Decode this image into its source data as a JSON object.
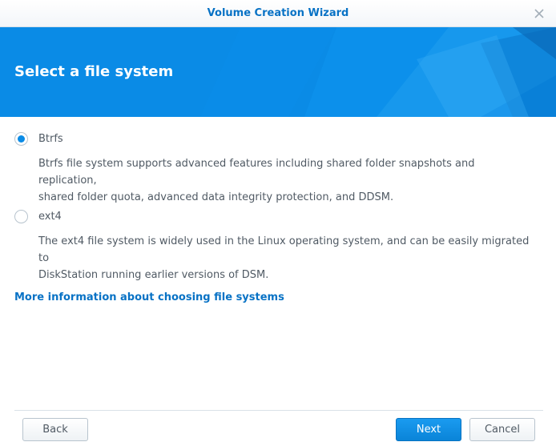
{
  "window": {
    "title": "Volume Creation Wizard"
  },
  "banner": {
    "title": "Select a file system"
  },
  "options": [
    {
      "label": "Btrfs",
      "checked": true,
      "description_line1": "Btrfs file system supports advanced features including shared folder snapshots and replication,",
      "description_line2": "shared folder quota, advanced data integrity protection, and DDSM."
    },
    {
      "label": "ext4",
      "checked": false,
      "description_line1": "The ext4 file system is widely used in the Linux operating system, and can be easily migrated to",
      "description_line2": "DiskStation running earlier versions of DSM."
    }
  ],
  "more_info_link": "More information about choosing file systems",
  "buttons": {
    "back": "Back",
    "next": "Next",
    "cancel": "Cancel"
  },
  "colors": {
    "accent": "#0A8BE6",
    "title_text": "#0872C5",
    "body_text": "#505A64"
  }
}
